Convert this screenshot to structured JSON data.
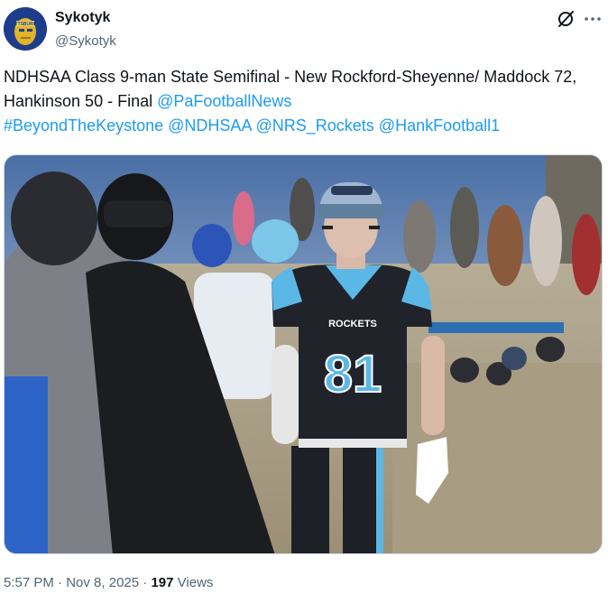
{
  "author": {
    "display_name": "Sykotyk",
    "handle": "@Sykotyk"
  },
  "tweet": {
    "text_plain": "NDHSAA Class 9-man State Semifinal - New Rockford-Sheyenne/ Maddock 72, Hankinson 50 - Final ",
    "mention_1": "@PaFootballNews",
    "hashtag_1": "#BeyondTheKeystone",
    "mention_2": "@NDHSAA",
    "mention_3": "@NRS_Rockets",
    "mention_4": "@HankFootball1"
  },
  "media": {
    "jersey_team": "ROCKETS",
    "jersey_number": "81"
  },
  "meta": {
    "time": "5:57 PM",
    "separator": "·",
    "date": "Nov 8, 2025",
    "views_count": "197",
    "views_label": "Views"
  },
  "icons": {
    "grok": "grok-icon",
    "more": "more-icon"
  },
  "colors": {
    "link": "#1d9bf0",
    "secondary_text": "#536471",
    "primary_text": "#0f1419",
    "jersey_blue": "#5bb8e6"
  }
}
